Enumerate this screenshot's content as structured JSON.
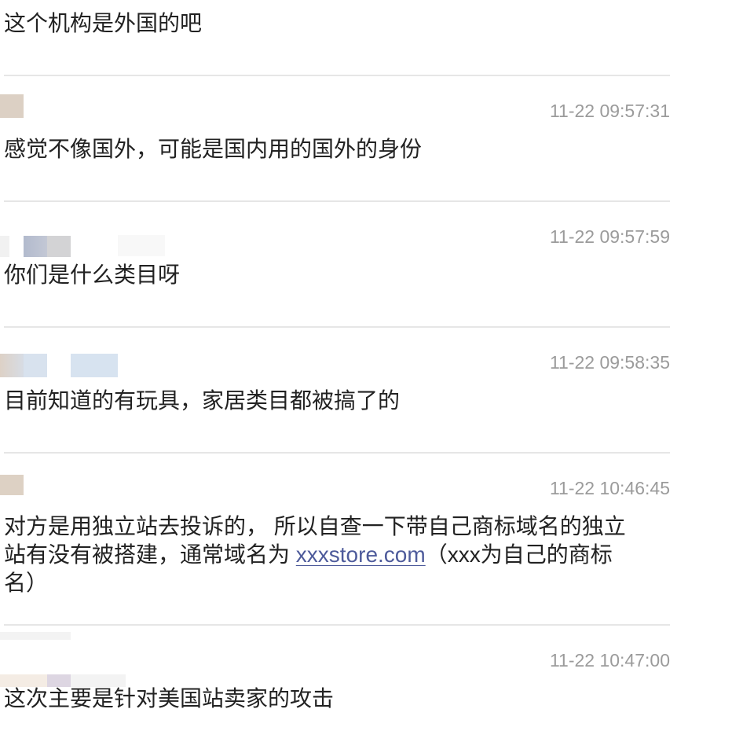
{
  "colors": {
    "text": "#222222",
    "timestamp": "#9b9b9b",
    "link": "#4e5b9b",
    "divider": "#e6e6e6"
  },
  "thread": {
    "top_message": "这个机构是外国的吧",
    "comments": [
      {
        "timestamp": "11-22 09:57:31",
        "text": "感觉不像国外，可能是国内用的国外的身份"
      },
      {
        "timestamp": "11-22 09:57:59",
        "text": "你们是什么类目呀"
      },
      {
        "timestamp": "11-22 09:58:35",
        "text": "目前知道的有玩具，家居类目都被搞了的"
      },
      {
        "timestamp": "11-22 10:46:45",
        "text_before": "对方是用独立站去投诉的， 所以自查一下带自己商标域名的独立站有没有被搭建，通常域名为 ",
        "link": "xxxstore.com",
        "text_after": "（xxx为自己的商标名）"
      },
      {
        "timestamp": "11-22 10:47:00",
        "text": "这次主要是针对美国站卖家的攻击"
      }
    ]
  }
}
